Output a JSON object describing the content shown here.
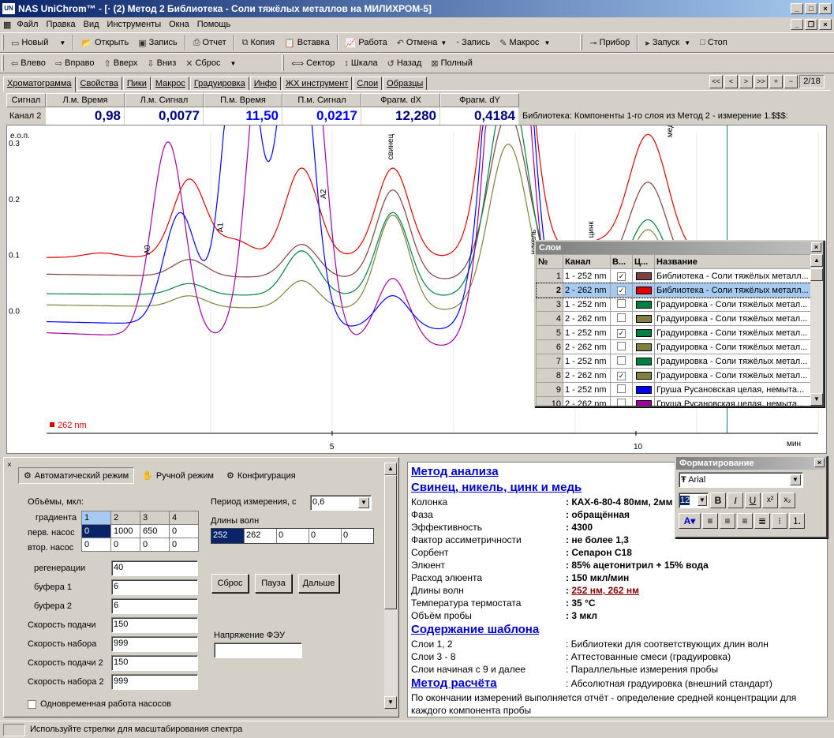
{
  "window": {
    "title": "NAS UniChrom™ - [· (2) Метод 2 Библиотека - Соли тяжёлых металлов  на  МИЛИХРОМ-5]"
  },
  "menu": [
    "Файл",
    "Правка",
    "Вид",
    "Инструменты",
    "Окна",
    "Помощь"
  ],
  "toolbar1": {
    "new": "Новый",
    "open": "Открыть",
    "save": "Запись",
    "report": "Отчет",
    "copy": "Копия",
    "paste": "Вставка",
    "work": "Работа",
    "cancel": "Отмена",
    "record": "Запись",
    "macro": "Макрос",
    "device": "Прибор",
    "start": "Запуск",
    "stop": "Стоп"
  },
  "toolbar2": {
    "left": "Влево",
    "right": "Вправо",
    "up": "Вверх",
    "down": "Вниз",
    "reset": "Сброс",
    "sector": "Сектор",
    "scale": "Шкала",
    "back": "Назад",
    "full": "Полный"
  },
  "tabs": [
    "Хроматограмма",
    "Свойства",
    "Пики",
    "Макрос",
    "Градуировка",
    "Инфо",
    "ЖХ инструмент",
    "Слои",
    "Образцы"
  ],
  "nav": {
    "buttons": [
      "<<",
      "<",
      ">",
      ">>",
      "+",
      "−"
    ],
    "page": "2/18"
  },
  "measure": {
    "headers": [
      "Сигнал",
      "Л.м. Время",
      "Л.м. Сигнал",
      "П.м. Время",
      "П.м. Сигнал",
      "Фрагм. dX",
      "Фрагм. dY"
    ],
    "channel": "Канал 2",
    "values": [
      "0,98",
      "0,0077",
      "11,50",
      "0,0217",
      "12,280",
      "0,4184"
    ],
    "library": "Библиотека: Компоненты 1-го слоя из Метод 2 - измерение 1.$$$:"
  },
  "chart_data": {
    "type": "line",
    "ylabel": "е.о.п.",
    "xlabel": "мин",
    "yticks": [
      "0.3",
      "0.2",
      "0.1",
      "0.0"
    ],
    "xticks": [
      "5",
      "10"
    ],
    "legend": "262 nm",
    "peak_labels": [
      "A0",
      "A1",
      "A2",
      "свинец",
      "никель",
      "цинк",
      "медь"
    ],
    "xlim": [
      0.3,
      13.0
    ],
    "ylim": [
      -0.22,
      0.32
    ],
    "series": [
      {
        "color": "#e00000",
        "baseline": 0.095,
        "drift": 0.0,
        "peaks": [
          [
            1.2,
            0.008
          ],
          [
            2.65,
            0.14
          ],
          [
            3.4,
            0.03
          ],
          [
            4.5,
            0.16
          ],
          [
            6.0,
            0.16
          ],
          [
            7.9,
            0.66
          ],
          [
            9.3,
            0.025
          ],
          [
            10.2,
            0.22
          ]
        ]
      },
      {
        "color": "#804040",
        "baseline": 0.065,
        "drift": -0.02,
        "peaks": [
          [
            2.65,
            0.03
          ],
          [
            4.5,
            0.06
          ],
          [
            6.0,
            0.16
          ],
          [
            7.9,
            0.3
          ],
          [
            9.3,
            0.02
          ],
          [
            10.2,
            0.18
          ]
        ]
      },
      {
        "color": "#008040",
        "baseline": 0.03,
        "drift": -0.01,
        "peaks": [
          [
            2.65,
            0.02
          ],
          [
            4.5,
            0.08
          ],
          [
            6.0,
            0.15
          ],
          [
            7.9,
            0.38
          ],
          [
            9.3,
            0.015
          ],
          [
            10.2,
            0.14
          ]
        ]
      },
      {
        "color": "#808040",
        "baseline": 0.01,
        "drift": -0.02,
        "peaks": [
          [
            2.65,
            0.02
          ],
          [
            4.5,
            0.05
          ],
          [
            6.0,
            0.17
          ],
          [
            7.9,
            0.3
          ],
          [
            9.3,
            0.02
          ],
          [
            10.2,
            0.15
          ]
        ]
      },
      {
        "color": "#a000a0",
        "baseline": -0.04,
        "drift": -0.05,
        "peaks": [
          [
            2.3,
            0.35
          ],
          [
            3.9,
            0.6
          ],
          [
            4.6,
            0.6
          ],
          [
            6.0,
            0.12
          ],
          [
            7.9,
            0.8
          ],
          [
            9.3,
            0.01
          ],
          [
            10.2,
            0.1
          ]
        ]
      },
      {
        "color": "#0000ff",
        "baseline": -0.02,
        "drift": -0.03,
        "peaks": [
          [
            2.5,
            0.2
          ],
          [
            3.5,
            0.6
          ],
          [
            4.4,
            0.6
          ],
          [
            6.0,
            0.06
          ],
          [
            7.9,
            0.9
          ],
          [
            10.2,
            0.08
          ]
        ]
      }
    ]
  },
  "layers": {
    "title": "Слои",
    "headers": [
      "№",
      "Канал",
      "В...",
      "Ц...",
      "Название"
    ],
    "rows": [
      {
        "n": "1",
        "ch": "1 - 252 nm",
        "v": true,
        "color": "#804040",
        "name": "Библиотека - Соли тяжёлых металл..."
      },
      {
        "n": "2",
        "ch": "2 - 262 nm",
        "v": true,
        "color": "#e00000",
        "name": "Библиотека - Соли тяжёлых металл...",
        "selected": true
      },
      {
        "n": "3",
        "ch": "1 - 252 nm",
        "v": false,
        "color": "#008040",
        "name": "Градуировка - Соли тяжёлых метал..."
      },
      {
        "n": "4",
        "ch": "2 - 262 nm",
        "v": false,
        "color": "#808040",
        "name": "Градуировка - Соли тяжёлых метал..."
      },
      {
        "n": "5",
        "ch": "1 - 252 nm",
        "v": true,
        "color": "#008040",
        "name": "Градуировка - Соли тяжёлых метал..."
      },
      {
        "n": "6",
        "ch": "2 - 262 nm",
        "v": false,
        "color": "#808040",
        "name": "Градуировка - Соли тяжёлых метал..."
      },
      {
        "n": "7",
        "ch": "1 - 252 nm",
        "v": false,
        "color": "#008040",
        "name": "Градуировка - Соли тяжёлых метал..."
      },
      {
        "n": "8",
        "ch": "2 - 262 nm",
        "v": true,
        "color": "#808040",
        "name": "Градуировка - Соли тяжёлых метал..."
      },
      {
        "n": "9",
        "ch": "1 - 252 nm",
        "v": false,
        "color": "#0000ff",
        "name": "Груша Русановская целая, немыта..."
      },
      {
        "n": "10",
        "ch": "2 - 262 nm",
        "v": false,
        "color": "#a000a0",
        "name": "Груша Русановская целая, немыта..."
      }
    ]
  },
  "control": {
    "tabs": [
      "Автоматический режим",
      "Ручной режим",
      "Конфигурация"
    ],
    "volumes_label": "Объёмы, мкл:",
    "gradient_label": "градиента",
    "grad_cols": [
      "1",
      "2",
      "3",
      "4"
    ],
    "pump1_label": "перв. насос",
    "pump1": [
      "0",
      "1000",
      "650",
      "0"
    ],
    "pump2_label": "втор. насос",
    "pump2": [
      "0",
      "0",
      "0",
      "0"
    ],
    "fields": [
      {
        "label": "регенерации",
        "value": "40"
      },
      {
        "label": "буфера 1",
        "value": "6"
      },
      {
        "label": "буфера 2",
        "value": "6"
      },
      {
        "label": "Скорость подачи",
        "value": "150"
      },
      {
        "label": "Скорость набора",
        "value": "999"
      },
      {
        "label": "Скорость подачи 2",
        "value": "150"
      },
      {
        "label": "Скорость набора 2",
        "value": "999"
      }
    ],
    "period_label": "Период измерения, с",
    "period": "0,6",
    "wavelengths_label": "Длины волн",
    "wavelengths": [
      "252",
      "262",
      "0",
      "0",
      "0"
    ],
    "btn_reset": "Сброс",
    "btn_pause": "Пауза",
    "btn_next": "Дальше",
    "voltage_label": "Напряжение ФЭУ",
    "checkbox_label": "Одновременная работа насосов"
  },
  "method": {
    "h1": "Метод анализа",
    "h2": "Свинец, никель, цинк и медь",
    "rows": [
      {
        "k": "Колонка",
        "v": "КАХ-6-80-4 80мм, 2мм"
      },
      {
        "k": "Фаза",
        "v": "обращённая"
      },
      {
        "k": "Эффективность",
        "v": "4300"
      },
      {
        "k": "Фактор ассиметричности",
        "v": "не более 1,3"
      },
      {
        "k": "Сорбент",
        "v": "Сепарон С18"
      },
      {
        "k": "Элюент",
        "v": "85% ацетонитрил + 15% вода"
      },
      {
        "k": "Расход элюента",
        "v": "150 мкл/мин"
      },
      {
        "k": "Длины волн",
        "v": "252 нм, 262 нм"
      },
      {
        "k": "Температура термостата",
        "v": "35 °C"
      },
      {
        "k": "Объём пробы",
        "v": "3 мкл"
      }
    ],
    "h3": "Содержание шаблона",
    "rows2": [
      {
        "k": "Слои 1, 2",
        "v": "Библиотеки для соответствующих длин волн"
      },
      {
        "k": "Слои 3 - 8",
        "v": "Аттестованные смеси (градуировка)"
      },
      {
        "k": "Слои начиная с 9 и далее",
        "v": "Параллельные измерения пробы"
      }
    ],
    "h4": "Метод расчёта",
    "calc": "Абсолютная градуировка (внешний стандарт)",
    "footer": "По окончании измерений выполняется отчёт - определение средней концентрации для каждого компонента пробы"
  },
  "format": {
    "title": "Форматирование",
    "font": "Arial",
    "size": "12"
  },
  "status": "Используйте стрелки для масштабирования спектра"
}
